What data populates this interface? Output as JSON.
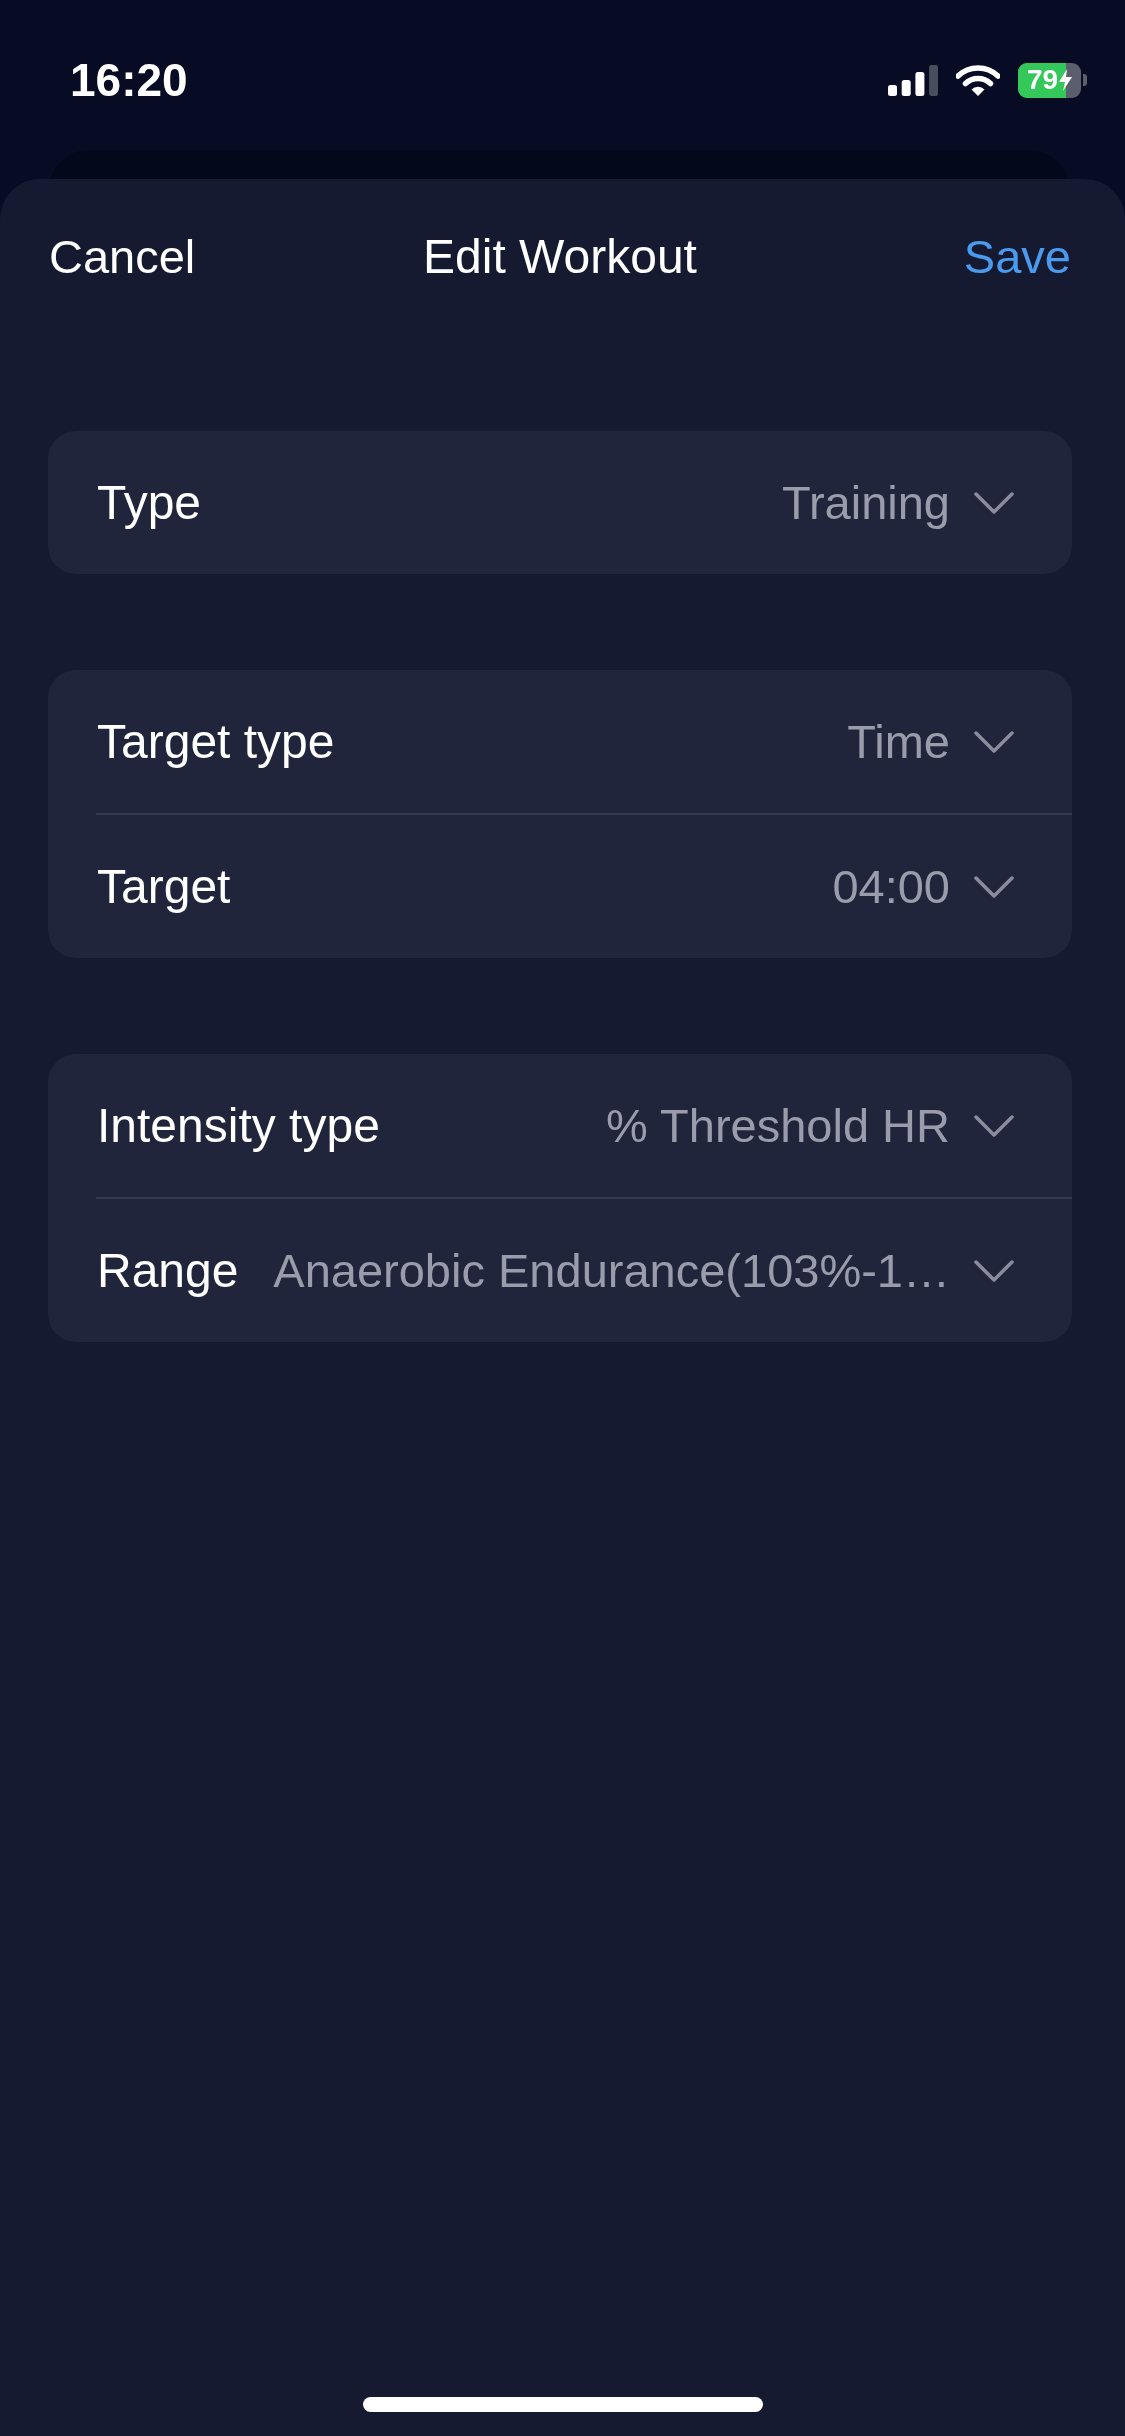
{
  "status_bar": {
    "time": "16:20",
    "battery": {
      "text": "79",
      "charging": true
    }
  },
  "nav": {
    "cancel": "Cancel",
    "title": "Edit Workout",
    "save": "Save"
  },
  "sections": [
    {
      "rows": [
        {
          "label": "Type",
          "value": "Training"
        }
      ]
    },
    {
      "rows": [
        {
          "label": "Target type",
          "value": "Time"
        },
        {
          "label": "Target",
          "value": "04:00"
        }
      ]
    },
    {
      "rows": [
        {
          "label": "Intensity type",
          "value": "% Threshold HR"
        },
        {
          "label": "Range",
          "value": "Anaerobic Endurance(103%-1…"
        }
      ]
    }
  ]
}
